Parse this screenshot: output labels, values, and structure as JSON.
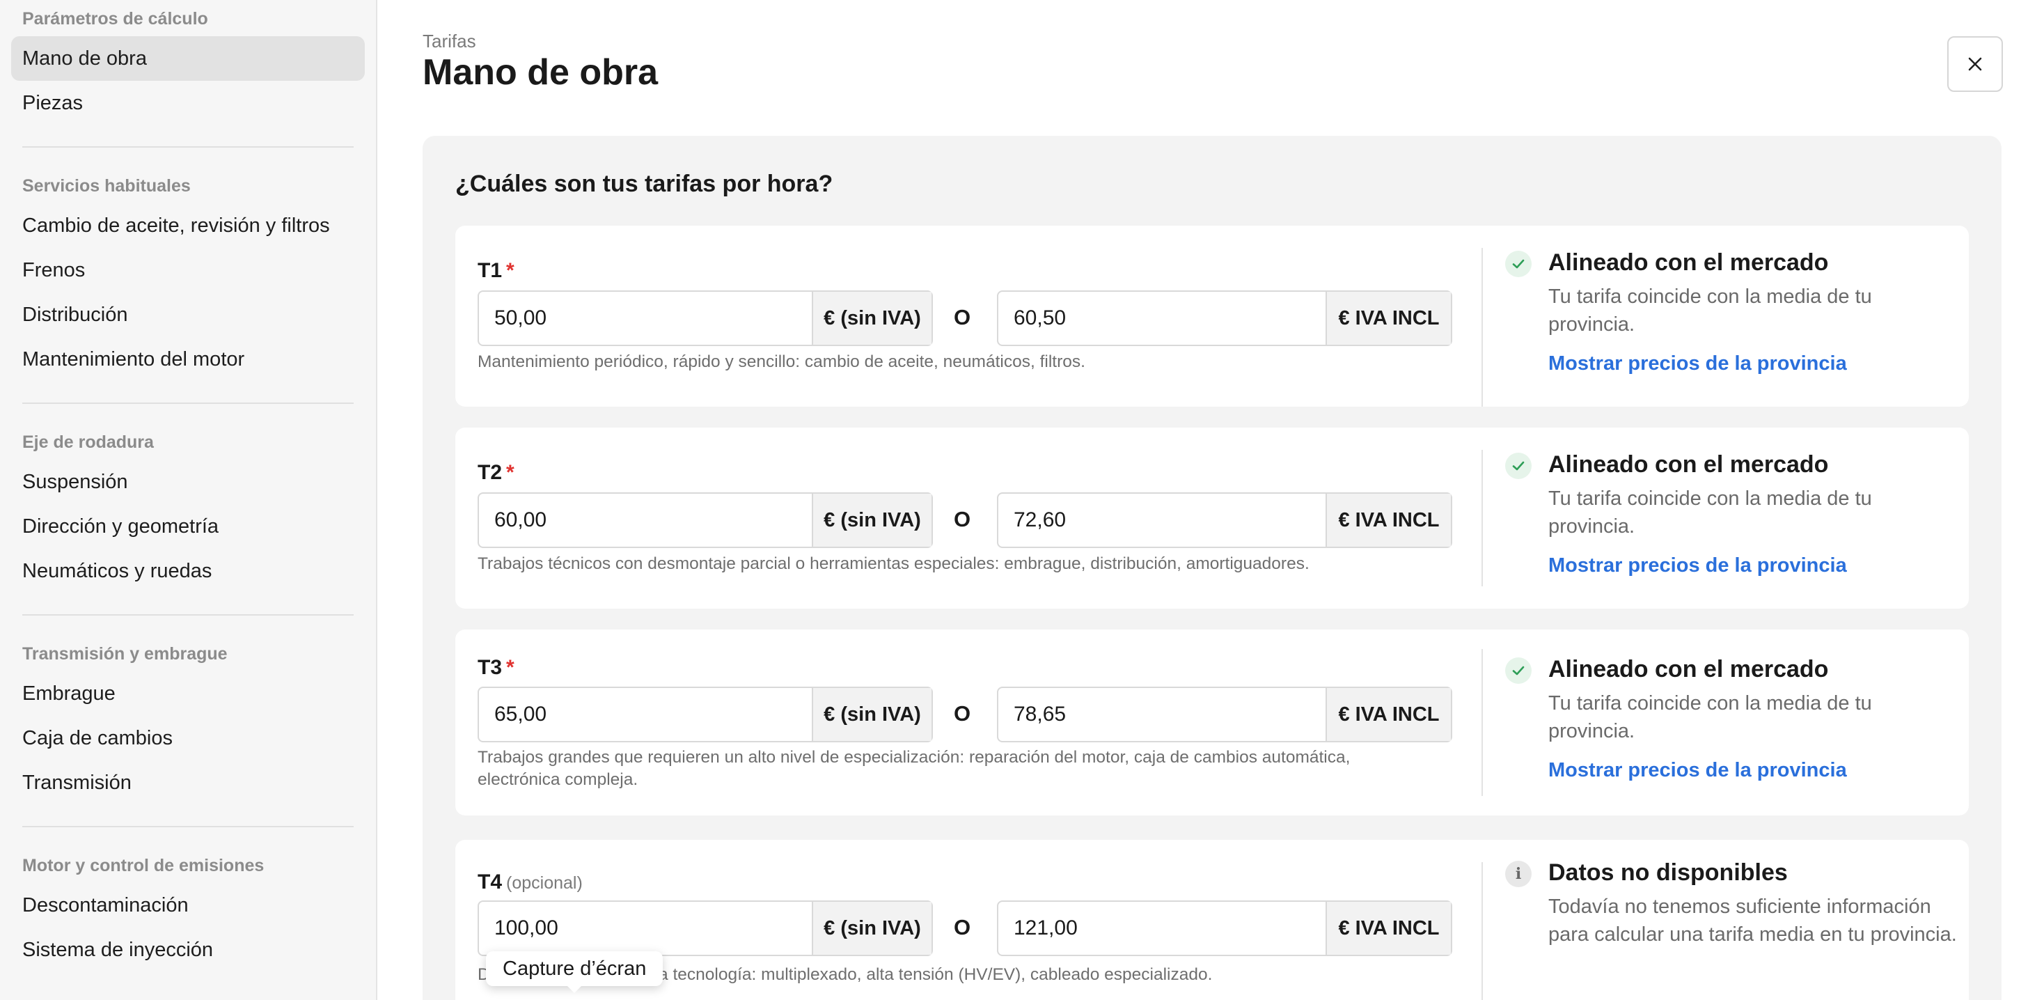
{
  "sidebar": {
    "sections": [
      {
        "title": "Parámetros de cálculo",
        "items": [
          "Mano de obra",
          "Piezas"
        ]
      },
      {
        "title": "Servicios habituales",
        "items": [
          "Cambio de aceite, revisión y filtros",
          "Frenos",
          "Distribución",
          "Mantenimiento del motor"
        ]
      },
      {
        "title": "Eje de rodadura",
        "items": [
          "Suspensión",
          "Dirección y geometría",
          "Neumáticos y ruedas"
        ]
      },
      {
        "title": "Transmisión y embrague",
        "items": [
          "Embrague",
          "Caja de cambios",
          "Transmisión"
        ]
      },
      {
        "title": "Motor y control de emisiones",
        "items": [
          "Descontaminación",
          "Sistema de inyección"
        ]
      }
    ],
    "active_item": "Mano de obra"
  },
  "header": {
    "eyebrow": "Tarifas",
    "title": "Mano de obra"
  },
  "panel": {
    "question": "¿Cuáles son tus tarifas por hora?",
    "or_label": "O",
    "unit_excl": "€ (sin IVA)",
    "unit_incl": "€ IVA INCL",
    "required_mark": "*",
    "tiers": [
      {
        "label": "T1",
        "optional_note": "",
        "value_excl": "50,00",
        "value_incl": "60,50",
        "help": "Mantenimiento periódico, rápido y sencillo: cambio de aceite, neumáticos, filtros.",
        "status": "ok",
        "status_title": "Alineado con el mercado",
        "status_desc": "Tu tarifa coincide con la media de tu provincia.",
        "status_link": "Mostrar precios de la provincia"
      },
      {
        "label": "T2",
        "optional_note": "",
        "value_excl": "60,00",
        "value_incl": "72,60",
        "help": "Trabajos técnicos con desmontaje parcial o herramientas especiales: embrague, distribución, amortiguadores.",
        "status": "ok",
        "status_title": "Alineado con el mercado",
        "status_desc": "Tu tarifa coincide con la media de tu provincia.",
        "status_link": "Mostrar precios de la provincia"
      },
      {
        "label": "T3",
        "optional_note": "",
        "value_excl": "65,00",
        "value_incl": "78,65",
        "help": "Trabajos grandes que requieren un alto nivel de especialización: reparación del motor, caja de cambios automática, electrónica compleja.",
        "status": "ok",
        "status_title": "Alineado con el mercado",
        "status_desc": "Tu tarifa coincide con la media de tu provincia.",
        "status_link": "Mostrar precios de la provincia"
      },
      {
        "label": "T4",
        "optional_note": "(opcional)",
        "value_excl": "100,00",
        "value_incl": "121,00",
        "help": "D                      ca de alta tecnología: multiplexado, alta tensión (HV/EV), cableado especializado.",
        "status": "info",
        "status_title": "Datos no disponibles",
        "status_desc": "Todavía no tenemos suficiente información para calcular una tarifa media en tu provincia.",
        "status_link": ""
      }
    ]
  },
  "tooltip": {
    "text": "Capture d’écran"
  },
  "icons": {
    "close": "close-icon",
    "check": "check-icon",
    "info": "info-icon"
  },
  "colors": {
    "accent_link": "#2a6fdb",
    "required": "#e0322f",
    "ok_check": "#2e9e57"
  }
}
